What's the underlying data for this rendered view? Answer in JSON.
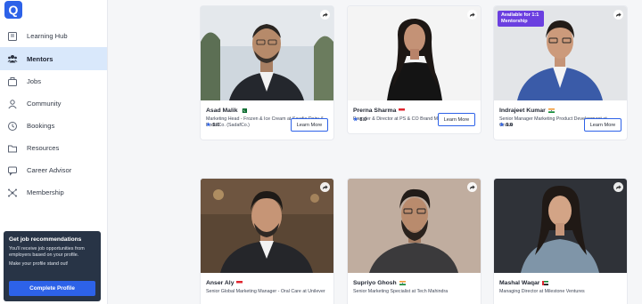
{
  "brand": {
    "logo_letter": "Q",
    "accent": "#2d62e8"
  },
  "sidebar": {
    "items": [
      {
        "label": "Learning Hub",
        "icon": "book-icon",
        "active": false
      },
      {
        "label": "Mentors",
        "icon": "people-icon",
        "active": true
      },
      {
        "label": "Jobs",
        "icon": "briefcase-icon",
        "active": false
      },
      {
        "label": "Community",
        "icon": "community-icon",
        "active": false
      },
      {
        "label": "Bookings",
        "icon": "clock-icon",
        "active": false
      },
      {
        "label": "Resources",
        "icon": "folder-icon",
        "active": false
      },
      {
        "label": "Career Advisor",
        "icon": "chat-icon",
        "active": false
      },
      {
        "label": "Membership",
        "icon": "network-icon",
        "active": false
      }
    ]
  },
  "promo": {
    "title": "Get job recommendations",
    "text": "You'll receive job opportunities from employers based on your profile.",
    "text2": "Make your profile stand out!",
    "button": "Complete Profile"
  },
  "mentors": [
    {
      "name": "Asad Malik",
      "flag": "flag-pakistan-icon",
      "role": "Marketing Head - Frozen & Ice Cream at Saudia Dairy & Food Co. (SadafCo.)",
      "rating": "5.0",
      "cta": "Learn More",
      "badge": ""
    },
    {
      "name": "Prerna Sharma",
      "flag": "flag-singapore-icon",
      "role": "Founder & Director at PS & CO Brand Marketing",
      "rating": "5.0",
      "cta": "Learn More",
      "badge": ""
    },
    {
      "name": "Indrajeet Kumar",
      "flag": "flag-india-icon",
      "role": "Senior Manager Marketing Product Development at Oracle",
      "rating": "5.0",
      "cta": "Learn More",
      "badge": "Available for 1:1 Mentorship"
    },
    {
      "name": "Anser Aly",
      "flag": "flag-singapore-icon",
      "role": "Senior Global Marketing Manager - Oral Care at Unilever",
      "rating": "",
      "cta": "",
      "badge": ""
    },
    {
      "name": "Supriyo Ghosh",
      "flag": "flag-india-icon",
      "role": "Senior Marketing Specialist at Tech Mahindra",
      "rating": "",
      "cta": "",
      "badge": ""
    },
    {
      "name": "Mashal Waqar",
      "flag": "flag-uae-icon",
      "role": "Managing Director at Milestone Ventures",
      "rating": "",
      "cta": "",
      "badge": ""
    }
  ]
}
